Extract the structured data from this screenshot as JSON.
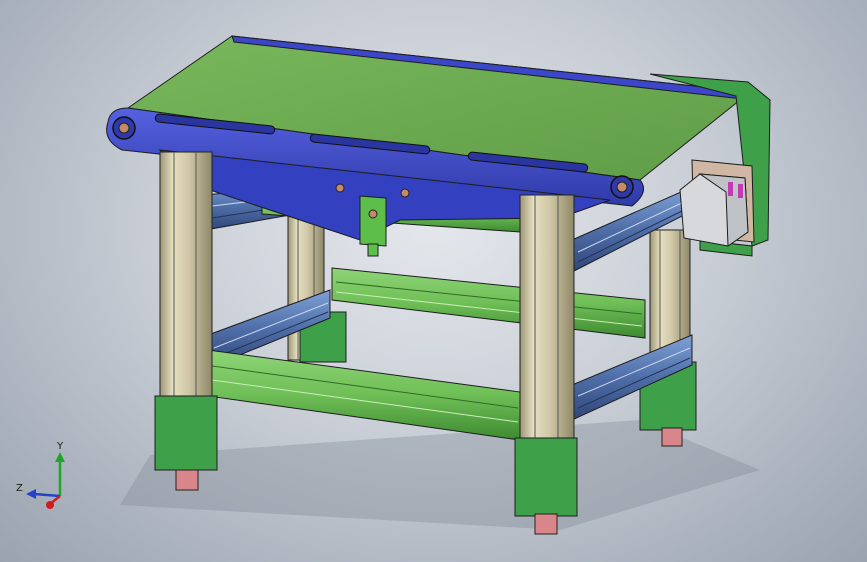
{
  "model_view": {
    "type": "3d-cad-assembly",
    "subject": "belt-conveyor-table",
    "colors": {
      "background_center": "#e4e7ec",
      "background_edge": "#9aa3af",
      "belt": "#6aa84f",
      "side_frame": "#3b47c8",
      "profile_aluminum": "#cfc7a6",
      "cross_member": "#6fbf57",
      "support_rail": "#4f6ea8",
      "foot_block": "#3fa04a",
      "leveling_foot": "#d9868a",
      "motor_body": "#d6d8db",
      "motor_accent": "#c23bb4",
      "mount_plate": "#cfb7a3"
    }
  },
  "triad": {
    "y_label": "Y",
    "z_label": "Z",
    "x_axis_color": "#d21c1c",
    "y_axis_color": "#1fa62a",
    "z_axis_color": "#2342c8"
  }
}
